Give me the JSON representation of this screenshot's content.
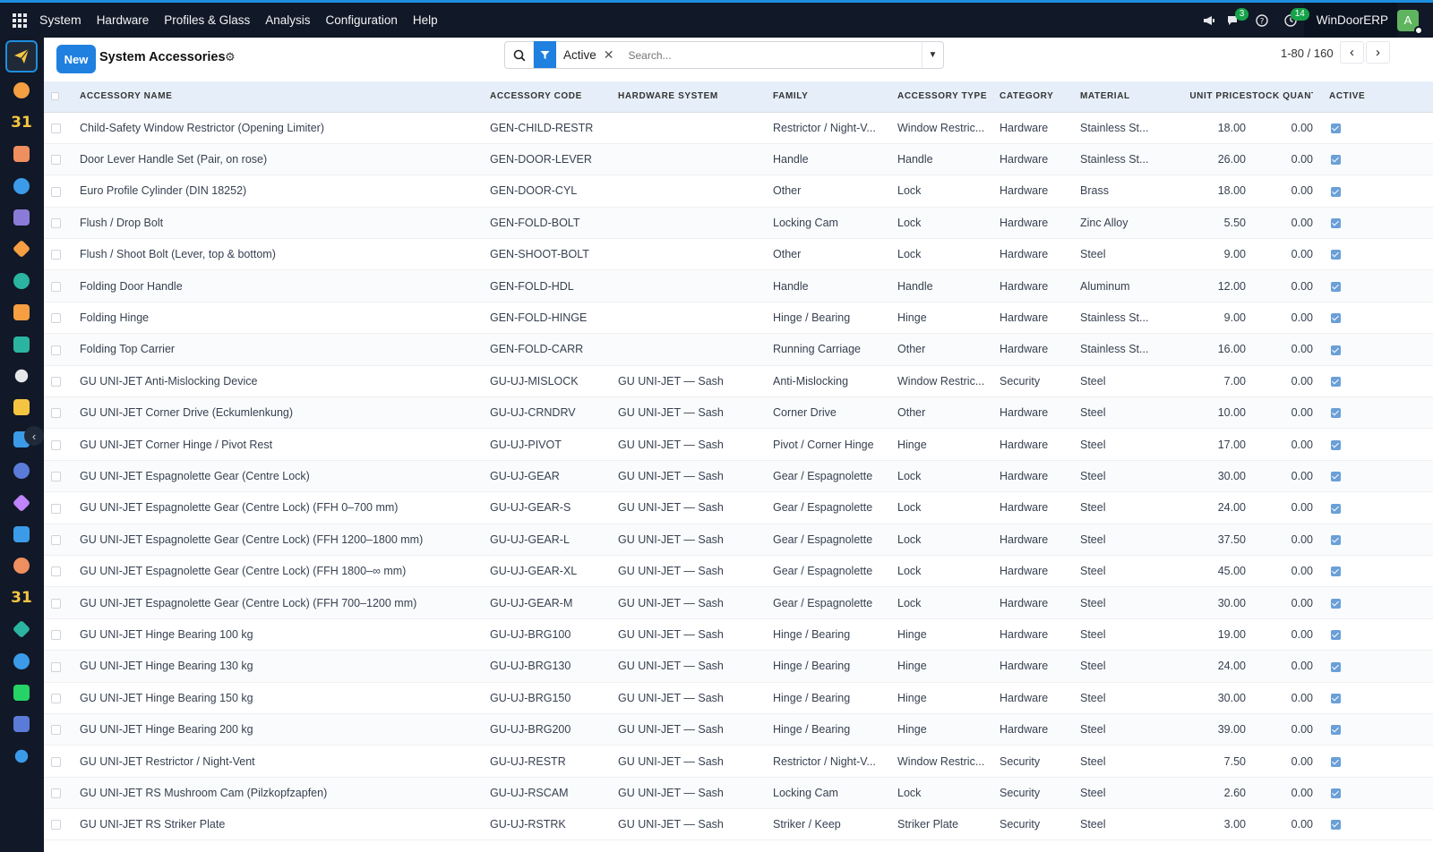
{
  "topbar": {
    "menu": [
      "System",
      "Hardware",
      "Profiles & Glass",
      "Analysis",
      "Configuration",
      "Help"
    ],
    "chat_badge": "3",
    "activity_badge": "14",
    "company": "WinDoorERP",
    "avatar_letter": "A"
  },
  "sidebar": {
    "items": [
      {
        "icon": "send-icon",
        "color": "#f5c542"
      },
      {
        "icon": "bar-chart-icon",
        "color": "#f59e42"
      },
      {
        "icon": "calendar-icon",
        "color": "#f5c542",
        "text": "31"
      },
      {
        "icon": "contacts-icon",
        "color": "#ef8e5e"
      },
      {
        "icon": "sales-icon",
        "color": "#3b9be8"
      },
      {
        "icon": "mail-icon",
        "color": "#8b7bd8"
      },
      {
        "icon": "discuss-icon",
        "color": "#f59e42"
      },
      {
        "icon": "website-icon",
        "color": "#2bb5a0"
      },
      {
        "icon": "reporting-icon",
        "color": "#f59e42"
      },
      {
        "icon": "employees-icon",
        "color": "#2bb5a0"
      },
      {
        "icon": "inventory-icon",
        "color": "#e5e7eb"
      },
      {
        "icon": "art-icon",
        "color": "#f5c542"
      },
      {
        "icon": "check-icon",
        "color": "#3b9be8"
      },
      {
        "icon": "helpdesk-icon",
        "color": "#5b7bd8"
      },
      {
        "icon": "package-icon",
        "color": "#c084fc"
      },
      {
        "icon": "invoice-icon",
        "color": "#3b9be8"
      },
      {
        "icon": "team-icon",
        "color": "#ef8e5e"
      },
      {
        "icon": "calendar-icon",
        "color": "#f5c542",
        "text": "31"
      },
      {
        "icon": "pen-icon",
        "color": "#2bb5a0"
      },
      {
        "icon": "dashboard-icon",
        "color": "#3b9be8"
      },
      {
        "icon": "whatsapp-icon",
        "color": "#25d366"
      },
      {
        "icon": "clock-icon",
        "color": "#5b7bd8"
      },
      {
        "icon": "wave-icon",
        "color": "#3b9be8"
      }
    ]
  },
  "control": {
    "new_label": "New",
    "title": "System Accessories",
    "facet_label": "Active",
    "search_placeholder": "Search...",
    "pager": "1-80 / 160"
  },
  "table": {
    "columns": [
      "Accessory Name",
      "Accessory Code",
      "Hardware System",
      "Family",
      "Accessory Type",
      "Category",
      "Material",
      "Unit Price",
      "Stock Quant...",
      "Active"
    ],
    "rows": [
      [
        "Child-Safety Window Restrictor (Opening Limiter)",
        "GEN-CHILD-RESTR",
        "",
        "Restrictor / Night-V...",
        "Window Restric...",
        "Hardware",
        "Stainless St...",
        "18.00",
        "0.00"
      ],
      [
        "Door Lever Handle Set (Pair, on rose)",
        "GEN-DOOR-LEVER",
        "",
        "Handle",
        "Handle",
        "Hardware",
        "Stainless St...",
        "26.00",
        "0.00"
      ],
      [
        "Euro Profile Cylinder (DIN 18252)",
        "GEN-DOOR-CYL",
        "",
        "Other",
        "Lock",
        "Hardware",
        "Brass",
        "18.00",
        "0.00"
      ],
      [
        "Flush / Drop Bolt",
        "GEN-FOLD-BOLT",
        "",
        "Locking Cam",
        "Lock",
        "Hardware",
        "Zinc Alloy",
        "5.50",
        "0.00"
      ],
      [
        "Flush / Shoot Bolt (Lever, top & bottom)",
        "GEN-SHOOT-BOLT",
        "",
        "Other",
        "Lock",
        "Hardware",
        "Steel",
        "9.00",
        "0.00"
      ],
      [
        "Folding Door Handle",
        "GEN-FOLD-HDL",
        "",
        "Handle",
        "Handle",
        "Hardware",
        "Aluminum",
        "12.00",
        "0.00"
      ],
      [
        "Folding Hinge",
        "GEN-FOLD-HINGE",
        "",
        "Hinge / Bearing",
        "Hinge",
        "Hardware",
        "Stainless St...",
        "9.00",
        "0.00"
      ],
      [
        "Folding Top Carrier",
        "GEN-FOLD-CARR",
        "",
        "Running Carriage",
        "Other",
        "Hardware",
        "Stainless St...",
        "16.00",
        "0.00"
      ],
      [
        "GU UNI-JET Anti-Mislocking Device",
        "GU-UJ-MISLOCK",
        "GU UNI-JET — Sash",
        "Anti-Mislocking",
        "Window Restric...",
        "Security",
        "Steel",
        "7.00",
        "0.00"
      ],
      [
        "GU UNI-JET Corner Drive (Eckumlenkung)",
        "GU-UJ-CRNDRV",
        "GU UNI-JET — Sash",
        "Corner Drive",
        "Other",
        "Hardware",
        "Steel",
        "10.00",
        "0.00"
      ],
      [
        "GU UNI-JET Corner Hinge / Pivot Rest",
        "GU-UJ-PIVOT",
        "GU UNI-JET — Sash",
        "Pivot / Corner Hinge",
        "Hinge",
        "Hardware",
        "Steel",
        "17.00",
        "0.00"
      ],
      [
        "GU UNI-JET Espagnolette Gear (Centre Lock)",
        "GU-UJ-GEAR",
        "GU UNI-JET — Sash",
        "Gear / Espagnolette",
        "Lock",
        "Hardware",
        "Steel",
        "30.00",
        "0.00"
      ],
      [
        "GU UNI-JET Espagnolette Gear (Centre Lock) (FFH 0–700 mm)",
        "GU-UJ-GEAR-S",
        "GU UNI-JET — Sash",
        "Gear / Espagnolette",
        "Lock",
        "Hardware",
        "Steel",
        "24.00",
        "0.00"
      ],
      [
        "GU UNI-JET Espagnolette Gear (Centre Lock) (FFH 1200–1800 mm)",
        "GU-UJ-GEAR-L",
        "GU UNI-JET — Sash",
        "Gear / Espagnolette",
        "Lock",
        "Hardware",
        "Steel",
        "37.50",
        "0.00"
      ],
      [
        "GU UNI-JET Espagnolette Gear (Centre Lock) (FFH 1800–∞ mm)",
        "GU-UJ-GEAR-XL",
        "GU UNI-JET — Sash",
        "Gear / Espagnolette",
        "Lock",
        "Hardware",
        "Steel",
        "45.00",
        "0.00"
      ],
      [
        "GU UNI-JET Espagnolette Gear (Centre Lock) (FFH 700–1200 mm)",
        "GU-UJ-GEAR-M",
        "GU UNI-JET — Sash",
        "Gear / Espagnolette",
        "Lock",
        "Hardware",
        "Steel",
        "30.00",
        "0.00"
      ],
      [
        "GU UNI-JET Hinge Bearing 100 kg",
        "GU-UJ-BRG100",
        "GU UNI-JET — Sash",
        "Hinge / Bearing",
        "Hinge",
        "Hardware",
        "Steel",
        "19.00",
        "0.00"
      ],
      [
        "GU UNI-JET Hinge Bearing 130 kg",
        "GU-UJ-BRG130",
        "GU UNI-JET — Sash",
        "Hinge / Bearing",
        "Hinge",
        "Hardware",
        "Steel",
        "24.00",
        "0.00"
      ],
      [
        "GU UNI-JET Hinge Bearing 150 kg",
        "GU-UJ-BRG150",
        "GU UNI-JET — Sash",
        "Hinge / Bearing",
        "Hinge",
        "Hardware",
        "Steel",
        "30.00",
        "0.00"
      ],
      [
        "GU UNI-JET Hinge Bearing 200 kg",
        "GU-UJ-BRG200",
        "GU UNI-JET — Sash",
        "Hinge / Bearing",
        "Hinge",
        "Hardware",
        "Steel",
        "39.00",
        "0.00"
      ],
      [
        "GU UNI-JET Restrictor / Night-Vent",
        "GU-UJ-RESTR",
        "GU UNI-JET — Sash",
        "Restrictor / Night-V...",
        "Window Restric...",
        "Security",
        "Steel",
        "7.50",
        "0.00"
      ],
      [
        "GU UNI-JET RS Mushroom Cam (Pilzkopfzapfen)",
        "GU-UJ-RSCAM",
        "GU UNI-JET — Sash",
        "Locking Cam",
        "Lock",
        "Security",
        "Steel",
        "2.60",
        "0.00"
      ],
      [
        "GU UNI-JET RS Striker Plate",
        "GU-UJ-RSTRK",
        "GU UNI-JET — Sash",
        "Striker / Keep",
        "Striker Plate",
        "Security",
        "Steel",
        "3.00",
        "0.00"
      ]
    ]
  }
}
